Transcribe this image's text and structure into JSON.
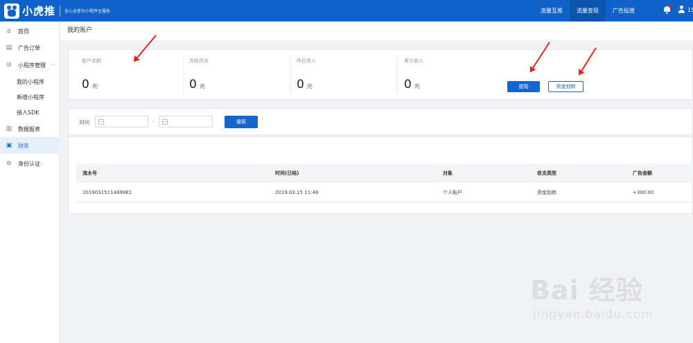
{
  "brand": {
    "name": "小虎推",
    "slogan": "全心全意为小程序主服务"
  },
  "topnav": {
    "items": [
      {
        "label": "流量互推"
      },
      {
        "label": "流量变现"
      },
      {
        "label": "广告投放"
      }
    ],
    "active": "流量变现",
    "user_text": "15"
  },
  "sidebar": {
    "items": [
      {
        "label": "首页",
        "icon": "home-icon"
      },
      {
        "label": "广告订单",
        "icon": "order-icon"
      },
      {
        "label": "小程序管理",
        "icon": "miniprogram-icon"
      },
      {
        "label": "我的小程序"
      },
      {
        "label": "新增小程序"
      },
      {
        "label": "接入SDK"
      },
      {
        "label": "数据报表",
        "icon": "chart-icon"
      },
      {
        "label": "财务",
        "icon": "finance-icon"
      },
      {
        "label": "身份认证",
        "icon": "id-icon"
      }
    ],
    "active": "财务"
  },
  "page": {
    "title": "我的账户"
  },
  "account": {
    "stats": [
      {
        "label": "账户余额",
        "value": "0",
        "unit": "元"
      },
      {
        "label": "冻结资金",
        "value": "0",
        "unit": "元"
      },
      {
        "label": "昨日收入",
        "value": "0",
        "unit": "元"
      },
      {
        "label": "累计收入",
        "value": "0",
        "unit": "元"
      }
    ],
    "withdraw_label": "提现",
    "transfer_label": "资金划转"
  },
  "filter": {
    "time_label": "时间",
    "range_sep": "-",
    "start_value": "",
    "end_value": "",
    "search_label": "搜索"
  },
  "table": {
    "columns": [
      "流水号",
      "时间(日结)",
      "对象",
      "收支类型",
      "广告金额"
    ],
    "rows": [
      [
        "2019031511489981",
        "2019.03.15 11:48",
        "个人账户",
        "资金划转",
        "+300.00"
      ]
    ]
  },
  "watermark": {
    "primary": "Bai 经验",
    "secondary": "jingyan.baidu.com"
  },
  "colors": {
    "topbar": "#0f62c8",
    "primary": "#1565d0",
    "active_bg": "#e6f0fc",
    "arrow": "#e8231d"
  }
}
